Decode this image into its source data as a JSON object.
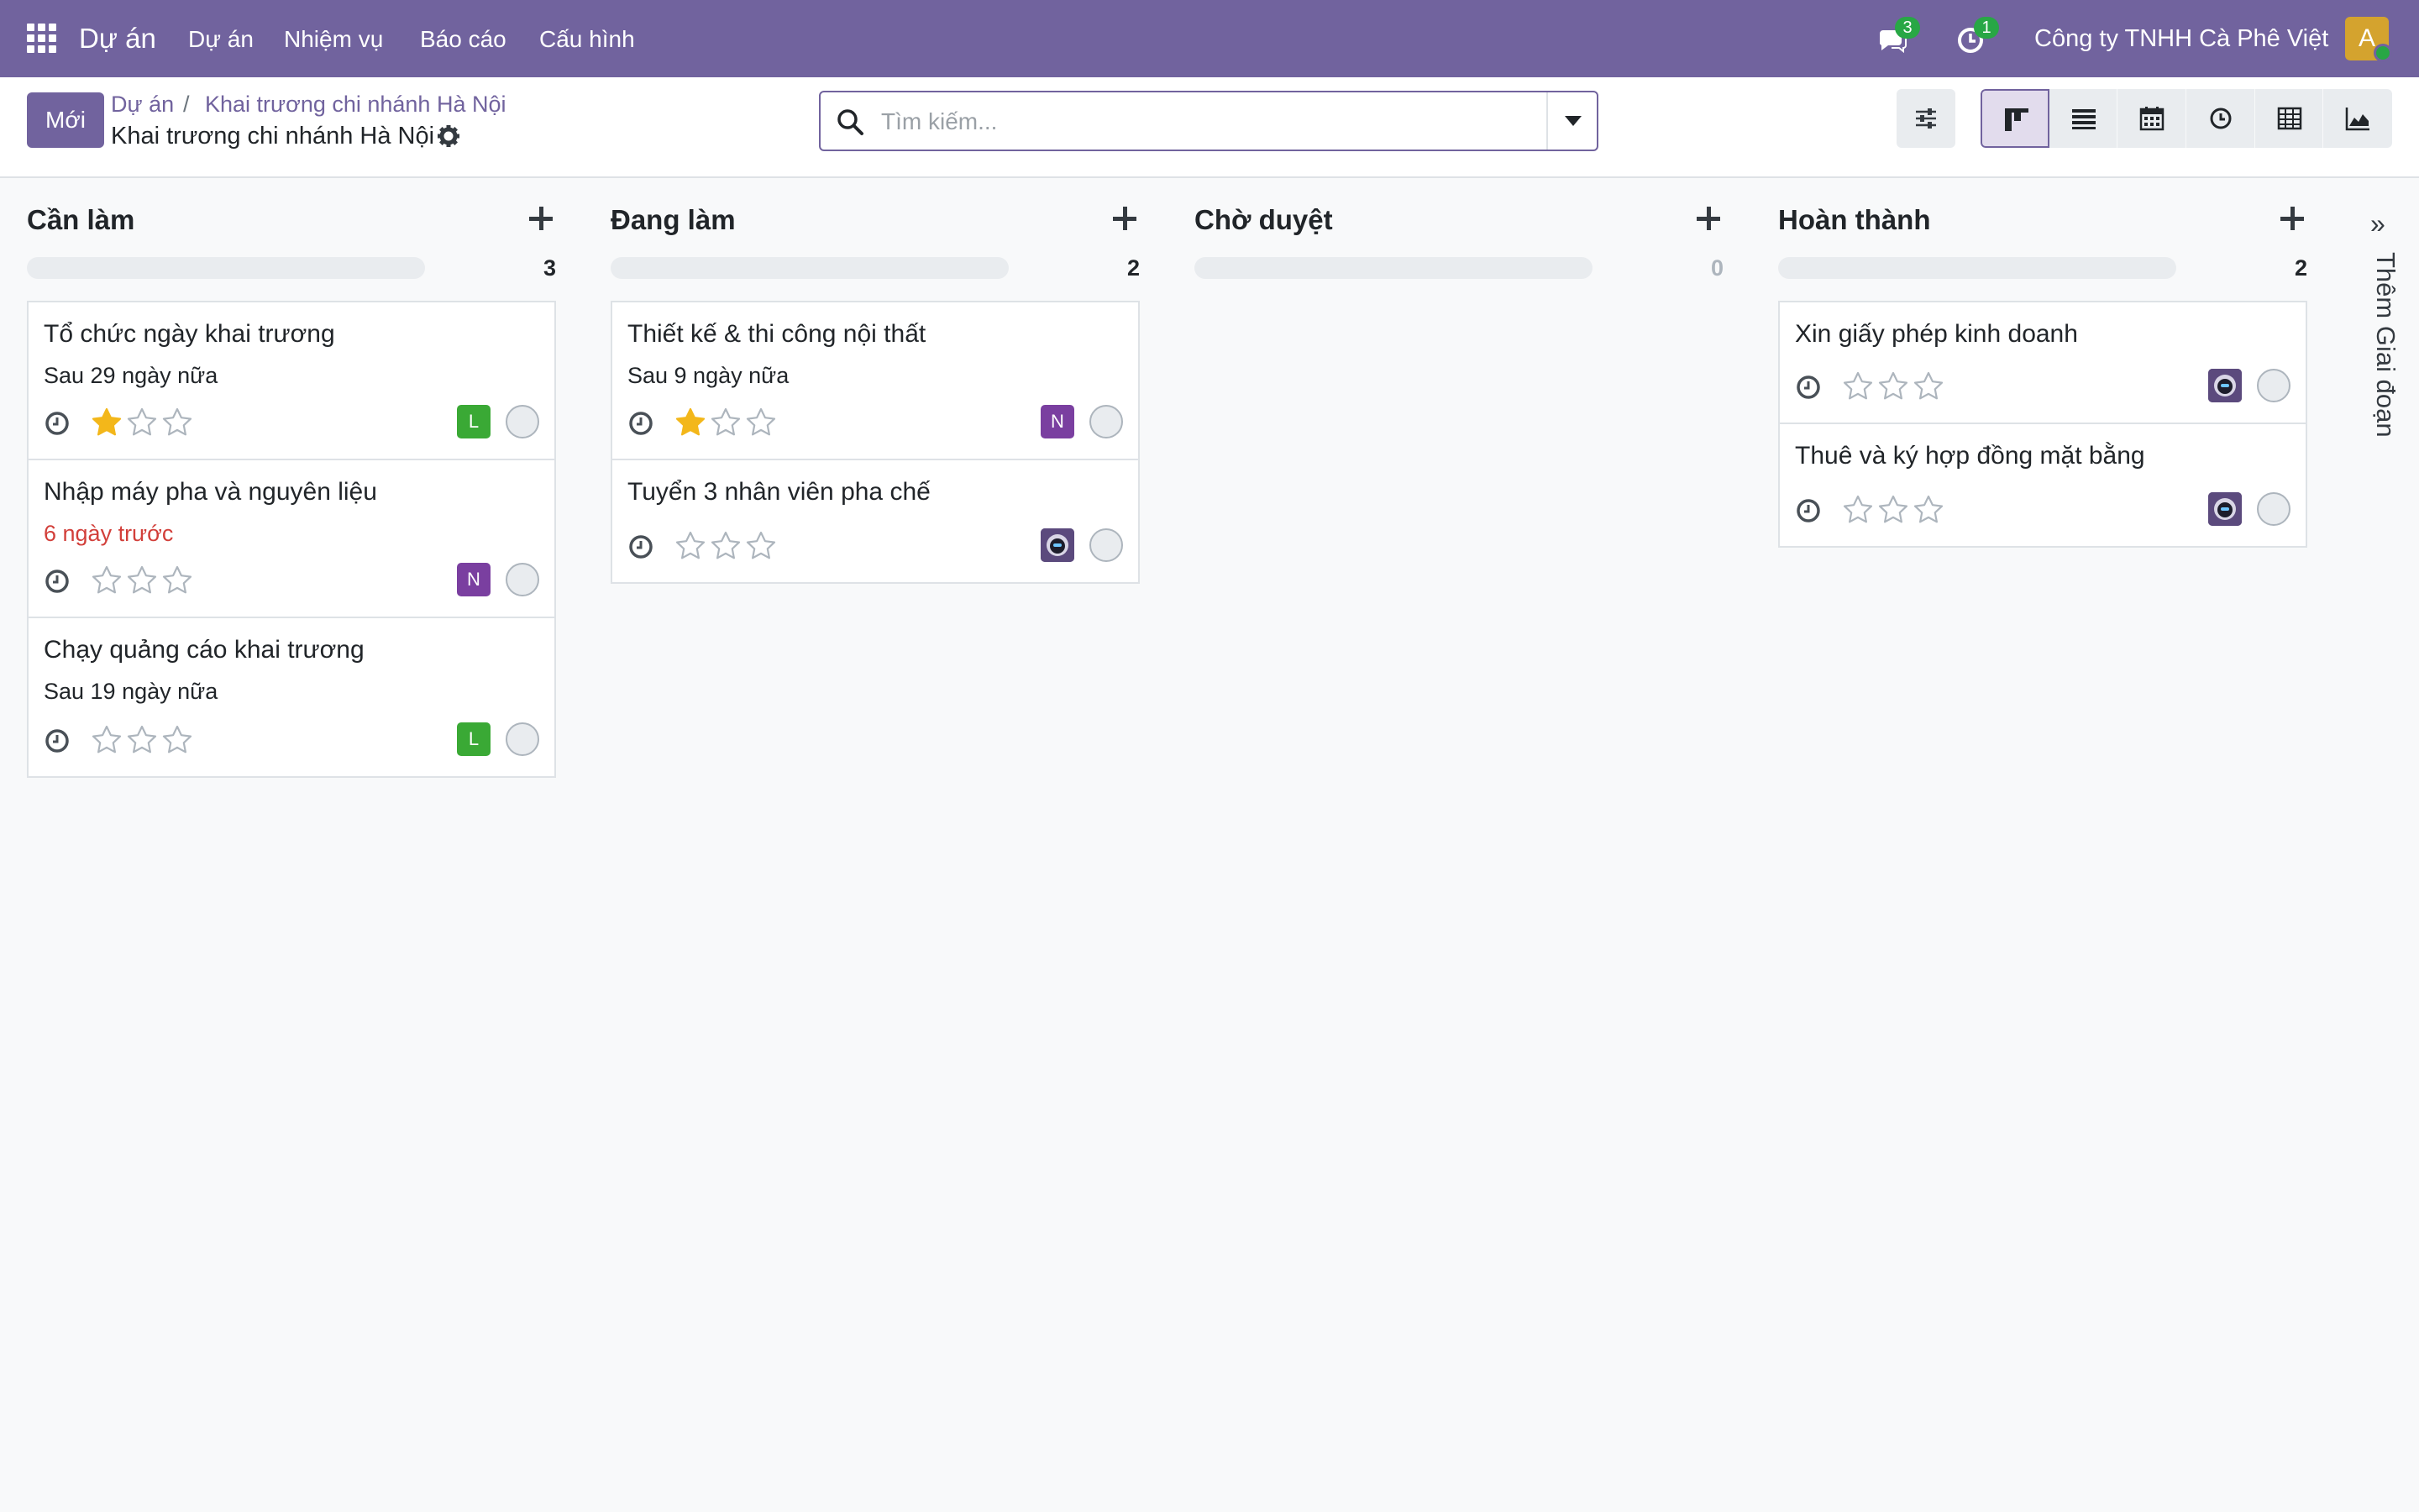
{
  "app": {
    "brand": "Dự án",
    "menu": [
      "Dự án",
      "Nhiệm vụ",
      "Báo cáo",
      "Cấu hình"
    ],
    "messages_badge": "3",
    "activities_badge": "1",
    "company": "Công ty TNHH Cà Phê Việt",
    "user_initial": "A",
    "accent_color": "#71639e"
  },
  "control": {
    "new_label": "Mới",
    "breadcrumb": [
      "Dự án",
      "Khai trương chi nhánh Hà Nội"
    ],
    "breadcrumb_separator": "/",
    "current": "Khai trương chi nhánh Hà Nội",
    "search_placeholder": "Tìm kiếm...",
    "views": [
      "kanban",
      "list",
      "calendar",
      "activity",
      "pivot",
      "graph"
    ],
    "active_view": "kanban"
  },
  "columns": [
    {
      "title": "Cần làm",
      "count": "3",
      "cards": [
        {
          "title": "Tổ chức ngày khai trương",
          "deadline": "Sau 29 ngày nữa",
          "overdue": false,
          "stars": 1,
          "assignee": "L",
          "assignee_color": "#3aa935"
        },
        {
          "title": "Nhập máy pha và nguyên liệu",
          "deadline": "6 ngày trước",
          "overdue": true,
          "stars": 0,
          "assignee": "N",
          "assignee_color": "#7a3fa0"
        },
        {
          "title": "Chạy quảng cáo khai trương",
          "deadline": "Sau 19 ngày nữa",
          "overdue": false,
          "stars": 0,
          "assignee": "L",
          "assignee_color": "#3aa935"
        }
      ]
    },
    {
      "title": "Đang làm",
      "count": "2",
      "cards": [
        {
          "title": "Thiết kế & thi công nội thất",
          "deadline": "Sau 9 ngày nữa",
          "overdue": false,
          "stars": 1,
          "assignee": "N",
          "assignee_color": "#7a3fa0"
        },
        {
          "title": "Tuyển 3 nhân viên pha chế",
          "deadline": "",
          "overdue": false,
          "stars": 0,
          "assignee": "",
          "assignee_color": ""
        }
      ]
    },
    {
      "title": "Chờ duyệt",
      "count": "0",
      "cards": []
    },
    {
      "title": "Hoàn thành",
      "count": "2",
      "cards": [
        {
          "title": "Xin giấy phép kinh doanh",
          "deadline": "",
          "overdue": false,
          "stars": 0,
          "assignee": "",
          "assignee_color": ""
        },
        {
          "title": "Thuê và ký hợp đồng mặt bằng",
          "deadline": "",
          "overdue": false,
          "stars": 0,
          "assignee": "",
          "assignee_color": ""
        }
      ]
    }
  ],
  "add_stage_label": "Thêm Giai đoạn",
  "star_color": "#f3b71a"
}
